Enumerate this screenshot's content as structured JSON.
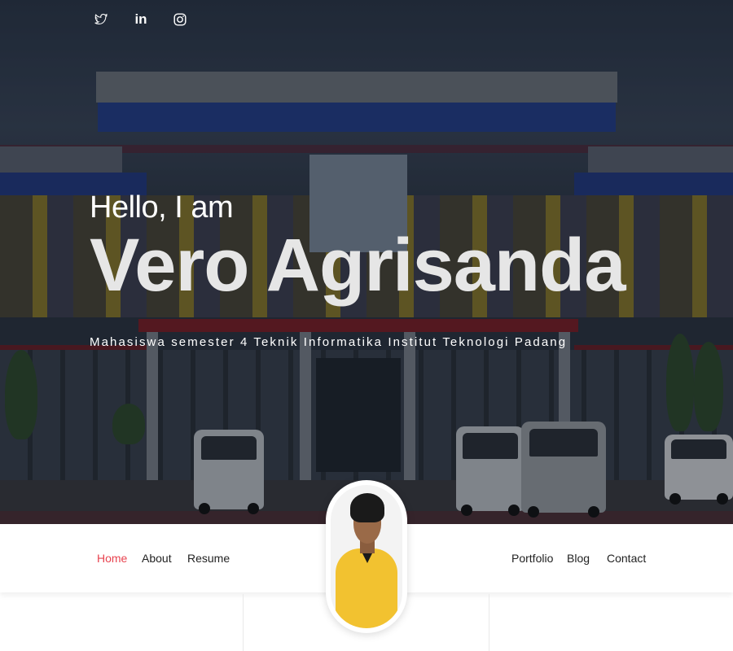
{
  "social": {
    "icons": [
      "twitter-icon",
      "linkedin-icon",
      "instagram-icon"
    ]
  },
  "hero": {
    "greeting": "Hello, I am",
    "name": "Vero Agrisanda",
    "subtitle": "Mahasiswa semester 4 Teknik Informatika Institut Teknologi Padang"
  },
  "nav": {
    "left": [
      {
        "label": "Home",
        "active": true
      },
      {
        "label": "About",
        "active": false
      },
      {
        "label": "Resume",
        "active": false
      }
    ],
    "right": [
      {
        "label": "Portfolio",
        "active": false
      },
      {
        "label": "Blog",
        "active": false
      },
      {
        "label": "Contact",
        "active": false
      }
    ]
  },
  "colors": {
    "accent": "#e8434f",
    "nav_text": "#222222",
    "hero_text": "#ffffff"
  }
}
